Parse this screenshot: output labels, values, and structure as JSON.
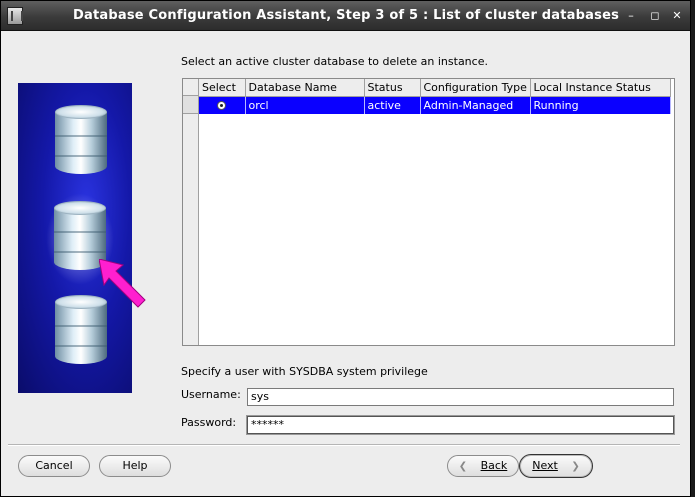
{
  "window": {
    "title": "Database Configuration Assistant, Step 3 of 5 : List of cluster databases",
    "controls": {
      "minimize": "–",
      "maximize": "◻",
      "close": "✕"
    }
  },
  "prompt": "Select an active cluster database to delete an instance.",
  "table": {
    "columns": [
      "Select",
      "Database Name",
      "Status",
      "Configuration Type",
      "Local Instance Status"
    ],
    "rows": [
      {
        "selected": true,
        "database_name": "orcl",
        "status": "active",
        "configuration_type": "Admin-Managed",
        "local_instance_status": "Running"
      }
    ]
  },
  "credentials": {
    "prompt": "Specify a user with SYSDBA system privilege",
    "username_label": "Username:",
    "username_value": "sys",
    "password_label": "Password:",
    "password_value": "******"
  },
  "buttons": {
    "cancel": "Cancel",
    "help": "Help",
    "back": "Back",
    "next": "Next"
  },
  "colors": {
    "selection": "#0a00ff",
    "side_panel": "#1418a8",
    "arrow": "#ff1fcf"
  }
}
